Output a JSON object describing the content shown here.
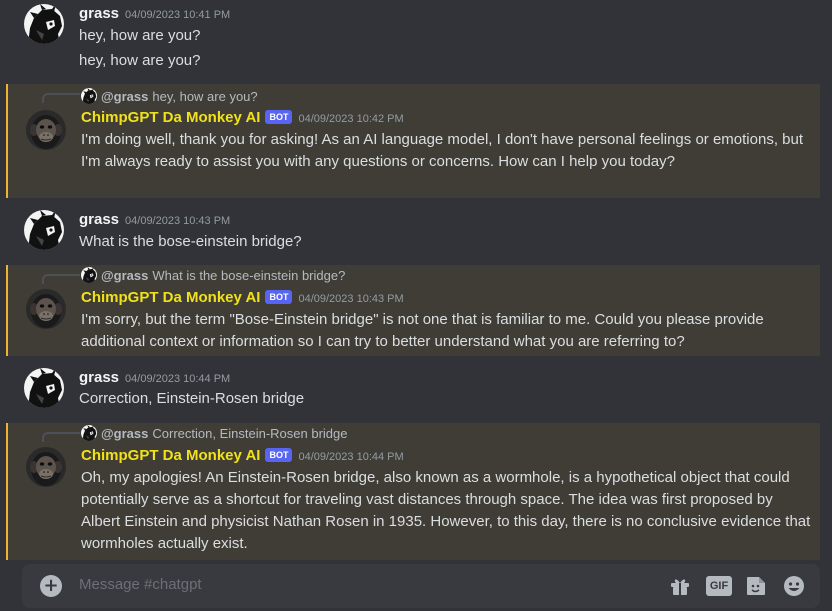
{
  "channel": {
    "composer_placeholder": "Message #chatgpt"
  },
  "messages": [
    {
      "author": "grass",
      "timestamp": "04/09/2023 10:41 PM",
      "lines": [
        "hey, how are you?",
        "hey, how are you?"
      ]
    },
    {
      "reply_to": {
        "author": "@grass",
        "text": "hey, how are you?"
      },
      "author": "ChimpGPT Da Monkey AI",
      "bot_tag": "BOT",
      "timestamp": "04/09/2023 10:42 PM",
      "text": "I'm doing well, thank you for asking! As an AI language model, I don't have personal feelings or emotions, but I'm always ready to assist you with any questions or concerns. How can I help you today?"
    },
    {
      "author": "grass",
      "timestamp": "04/09/2023 10:43 PM",
      "text": "What is the bose-einstein bridge?"
    },
    {
      "reply_to": {
        "author": "@grass",
        "text": "What is the bose-einstein bridge?"
      },
      "author": "ChimpGPT Da Monkey AI",
      "bot_tag": "BOT",
      "timestamp": "04/09/2023 10:43 PM",
      "text": "I'm sorry, but the term \"Bose-Einstein bridge\" is not one that is familiar to me. Could you please provide additional context or information so I can try to better understand what you are referring to?"
    },
    {
      "author": "grass",
      "timestamp": "04/09/2023 10:44 PM",
      "text": "Correction, Einstein-Rosen bridge"
    },
    {
      "reply_to": {
        "author": "@grass",
        "text": "Correction, Einstein-Rosen bridge"
      },
      "author": "ChimpGPT Da Monkey AI",
      "bot_tag": "BOT",
      "timestamp": "04/09/2023 10:44 PM",
      "text": "Oh, my apologies! An Einstein-Rosen bridge, also known as a wormhole, is a hypothetical object that could potentially serve as a shortcut for traveling vast distances through space. The idea was first proposed by Albert Einstein and physicist Nathan Rosen in 1935. However, to this day, there is no conclusive evidence that wormholes actually exist."
    }
  ],
  "composer_icons": {
    "gift": "gift-icon",
    "gif": "GIF",
    "sticker": "sticker-icon",
    "emoji": "emoji-icon"
  },
  "colors": {
    "background": "#313338",
    "mention_highlight": "#3f3d36",
    "mention_border": "#f0b232",
    "bot_name": "#f0e11a",
    "bot_tag": "#5865f2"
  }
}
